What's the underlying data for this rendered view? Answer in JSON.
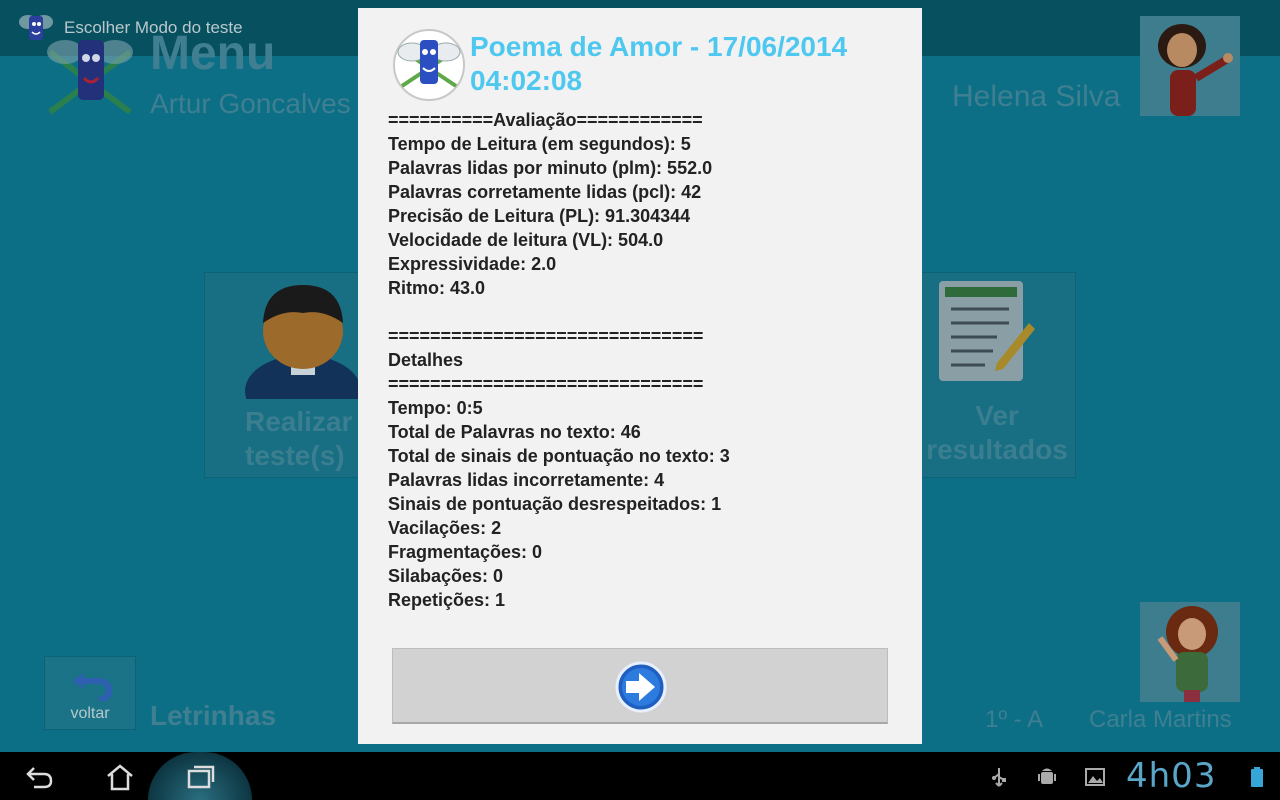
{
  "background_app": {
    "action_bar_title": "Escolher Modo do teste",
    "menu_title": "Menu",
    "student_name": "Artur Goncalves",
    "teacher_name": "Helena Silva",
    "tiles": {
      "take_test": "Realizar teste(s)",
      "view_results": "Ver resultados"
    },
    "back_label": "voltar",
    "app_name": "Letrinhas",
    "class_name": "1º - A",
    "footer_teacher": "Carla Martins"
  },
  "dialog": {
    "title": "Poema de Amor - 17/06/2014 04:02:08",
    "evaluation_header": "==========Avaliação============",
    "evaluation": [
      "Tempo de Leitura (em segundos): 5",
      "Palavras lidas por minuto (plm): 552.0",
      "Palavras corretamente lidas (pcl): 42",
      "Precisão de Leitura (PL): 91.304344",
      "Velocidade de leitura (VL): 504.0",
      "Expressividade: 2.0",
      "Ritmo: 43.0"
    ],
    "separator": "==============================",
    "details_header": "Detalhes",
    "details": [
      "Tempo: 0:5",
      "Total de Palavras no texto: 46",
      "Total de sinais de pontuação no texto: 3",
      "Palavras lidas incorretamente: 4",
      "Sinais de pontuação desrespeitados: 1",
      "Vacilações: 2",
      "Fragmentações: 0",
      "Silabações: 0",
      "Repetições: 1"
    ],
    "next_button_icon": "arrow-right-icon"
  },
  "system_bar": {
    "clock": "4h03",
    "icons": [
      "back-icon",
      "home-icon",
      "recent-apps-icon",
      "usb-icon",
      "android-debug-icon",
      "gallery-icon",
      "battery-icon"
    ]
  },
  "colors": {
    "app_background": "#0c6f86",
    "dialog_title": "#4fc8f0",
    "clock": "#5aa6c9"
  }
}
